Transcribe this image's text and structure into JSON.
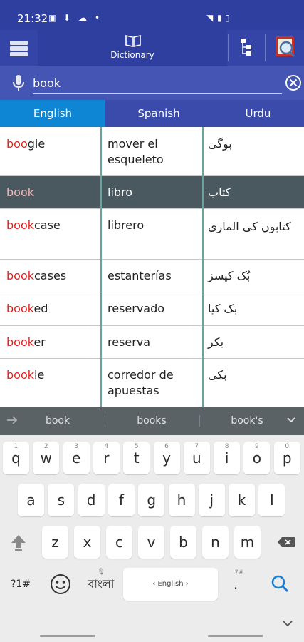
{
  "status": {
    "time": "21:32"
  },
  "toolbar": {
    "dictionary_label": "Dictionary"
  },
  "search": {
    "value": "book"
  },
  "tabs": [
    {
      "label": "English",
      "active": true
    },
    {
      "label": "Spanish",
      "active": false
    },
    {
      "label": "Urdu",
      "active": false
    }
  ],
  "rows": [
    {
      "en_hl": "boo",
      "en_rest": "gie",
      "es": "mover el esqueleto",
      "ur": "بوگی",
      "selected": false
    },
    {
      "en_hl": "book",
      "en_rest": "",
      "es": "libro",
      "ur": "کتاب",
      "selected": true
    },
    {
      "en_hl": "book",
      "en_rest": "case",
      "es": "librero",
      "ur": "کتابوں کی الماری",
      "selected": false
    },
    {
      "en_hl": "book",
      "en_rest": "cases",
      "es": "estanterías",
      "ur": "بُک کیسز",
      "selected": false
    },
    {
      "en_hl": "book",
      "en_rest": "ed",
      "es": "reservado",
      "ur": "بک کیا",
      "selected": false
    },
    {
      "en_hl": "book",
      "en_rest": "er",
      "es": "reserva",
      "ur": "بکر",
      "selected": false
    },
    {
      "en_hl": "book",
      "en_rest": "ie",
      "es": "corredor de apuestas",
      "ur": "بکی",
      "selected": false
    }
  ],
  "suggestions": [
    "book",
    "books",
    "book's"
  ],
  "keyboard": {
    "row1": [
      {
        "k": "q",
        "n": "1"
      },
      {
        "k": "w",
        "n": "2"
      },
      {
        "k": "e",
        "n": "3"
      },
      {
        "k": "r",
        "n": "4"
      },
      {
        "k": "t",
        "n": "5"
      },
      {
        "k": "y",
        "n": "6"
      },
      {
        "k": "u",
        "n": "7"
      },
      {
        "k": "i",
        "n": "8"
      },
      {
        "k": "o",
        "n": "9"
      },
      {
        "k": "p",
        "n": "0"
      }
    ],
    "row2": [
      "a",
      "s",
      "d",
      "f",
      "g",
      "h",
      "j",
      "k",
      "l"
    ],
    "row3": [
      "z",
      "x",
      "c",
      "v",
      "b",
      "n",
      "m"
    ],
    "symbols_key": "?1#",
    "language_key": "বাংলা",
    "space_label": "‹ English ›",
    "period_key": ".",
    "period_hint": "?#"
  },
  "colors": {
    "statusbar": "#2f3f9f",
    "toolbar": "#3545a7",
    "searchbar": "#4455b3",
    "active_tab": "#0e86d4",
    "selected_row": "#4a5860",
    "highlight_text": "#e02020",
    "search_icon": "#1a7fd4"
  },
  "icons": [
    "menu-icon",
    "book-icon",
    "tree-icon",
    "dictionary-search-icon",
    "mic-icon",
    "clear-icon",
    "arrow-right-icon",
    "chevron-down-icon",
    "shift-icon",
    "backspace-icon",
    "emoji-icon",
    "search-icon"
  ]
}
